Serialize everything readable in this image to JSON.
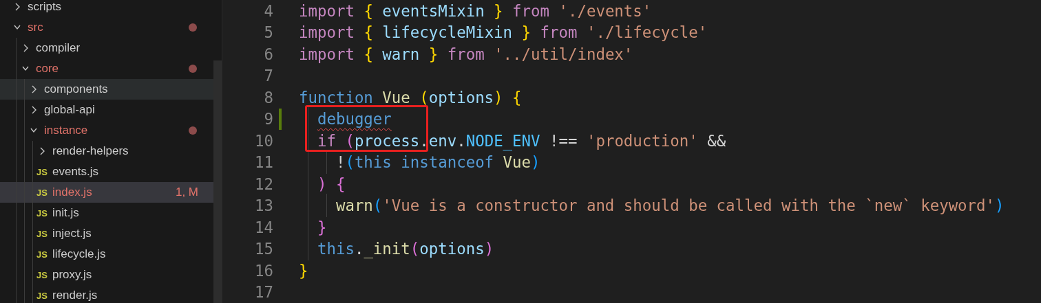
{
  "explorer": {
    "items": [
      {
        "kind": "folder",
        "label": "scripts",
        "expanded": false,
        "modified": false,
        "selected": false,
        "hovered": false
      },
      {
        "kind": "folder",
        "label": "src",
        "expanded": true,
        "modified": true,
        "selected": false,
        "hovered": false,
        "children": [
          {
            "kind": "folder",
            "label": "compiler",
            "expanded": false,
            "modified": false,
            "selected": false,
            "hovered": false
          },
          {
            "kind": "folder",
            "label": "core",
            "expanded": true,
            "modified": true,
            "selected": false,
            "hovered": false,
            "children": [
              {
                "kind": "folder",
                "label": "components",
                "expanded": false,
                "modified": false,
                "selected": false,
                "hovered": true
              },
              {
                "kind": "folder",
                "label": "global-api",
                "expanded": false,
                "modified": false,
                "selected": false,
                "hovered": false
              },
              {
                "kind": "folder",
                "label": "instance",
                "expanded": true,
                "modified": true,
                "selected": false,
                "hovered": false,
                "children": [
                  {
                    "kind": "folder",
                    "label": "render-helpers",
                    "expanded": false,
                    "modified": false,
                    "selected": false,
                    "hovered": false
                  },
                  {
                    "kind": "file",
                    "icon_text": "JS",
                    "label": "events.js",
                    "modified": false,
                    "selected": false,
                    "hovered": false
                  },
                  {
                    "kind": "file",
                    "icon_text": "JS",
                    "label": "index.js",
                    "modified": true,
                    "badge": "1, M",
                    "selected": true,
                    "hovered": false
                  },
                  {
                    "kind": "file",
                    "icon_text": "JS",
                    "label": "init.js",
                    "modified": false,
                    "selected": false,
                    "hovered": false
                  },
                  {
                    "kind": "file",
                    "icon_text": "JS",
                    "label": "inject.js",
                    "modified": false,
                    "selected": false,
                    "hovered": false
                  },
                  {
                    "kind": "file",
                    "icon_text": "JS",
                    "label": "lifecycle.js",
                    "modified": false,
                    "selected": false,
                    "hovered": false
                  },
                  {
                    "kind": "file",
                    "icon_text": "JS",
                    "label": "proxy.js",
                    "modified": false,
                    "selected": false,
                    "hovered": false
                  },
                  {
                    "kind": "file",
                    "icon_text": "JS",
                    "label": "render.js",
                    "modified": false,
                    "selected": false,
                    "hovered": false
                  }
                ]
              }
            ]
          }
        ]
      }
    ]
  },
  "editor": {
    "lines": [
      {
        "number": "4",
        "modified": false,
        "tokens": [
          {
            "kind": "kw",
            "text": "import "
          },
          {
            "kind": "b1",
            "text": "{"
          },
          {
            "kind": "var",
            "text": " eventsMixin "
          },
          {
            "kind": "b1",
            "text": "}"
          },
          {
            "kind": "kw",
            "text": " from "
          },
          {
            "kind": "str",
            "text": "'./events'"
          }
        ]
      },
      {
        "number": "5",
        "modified": false,
        "tokens": [
          {
            "kind": "kw",
            "text": "import "
          },
          {
            "kind": "b1",
            "text": "{"
          },
          {
            "kind": "var",
            "text": " lifecycleMixin "
          },
          {
            "kind": "b1",
            "text": "}"
          },
          {
            "kind": "kw",
            "text": " from "
          },
          {
            "kind": "str",
            "text": "'./lifecycle'"
          }
        ]
      },
      {
        "number": "6",
        "modified": false,
        "tokens": [
          {
            "kind": "kw",
            "text": "import "
          },
          {
            "kind": "b1",
            "text": "{"
          },
          {
            "kind": "var",
            "text": " warn "
          },
          {
            "kind": "b1",
            "text": "}"
          },
          {
            "kind": "kw",
            "text": " from "
          },
          {
            "kind": "str",
            "text": "'../util/index'"
          }
        ]
      },
      {
        "number": "7",
        "modified": false
      },
      {
        "number": "8",
        "modified": false,
        "tokens": [
          {
            "kind": "decl",
            "text": "function "
          },
          {
            "kind": "fn",
            "text": "Vue "
          },
          {
            "kind": "b1",
            "text": "("
          },
          {
            "kind": "var",
            "text": "options"
          },
          {
            "kind": "b1",
            "text": ") {"
          }
        ]
      },
      {
        "number": "9",
        "modified": true,
        "tokens": [
          {
            "kind": "decl",
            "text": "  debugger",
            "error": true
          }
        ]
      },
      {
        "number": "10",
        "modified": false,
        "tokens": [
          {
            "kind": "kw",
            "text": "  if "
          },
          {
            "kind": "b2",
            "text": "("
          },
          {
            "kind": "var",
            "text": "process"
          },
          {
            "kind": "op",
            "text": "."
          },
          {
            "kind": "var",
            "text": "env"
          },
          {
            "kind": "op",
            "text": "."
          },
          {
            "kind": "const",
            "text": "NODE_ENV"
          },
          {
            "kind": "op",
            "text": " !== "
          },
          {
            "kind": "str",
            "text": "'production'"
          },
          {
            "kind": "op",
            "text": " &&"
          }
        ]
      },
      {
        "number": "11",
        "modified": false,
        "tokens": [
          {
            "kind": "op",
            "text": "    !"
          },
          {
            "kind": "b3",
            "text": "("
          },
          {
            "kind": "decl",
            "text": "this instanceof "
          },
          {
            "kind": "fn",
            "text": "Vue"
          },
          {
            "kind": "b3",
            "text": ")"
          }
        ]
      },
      {
        "number": "12",
        "modified": false,
        "tokens": [
          {
            "kind": "b2",
            "text": "  ) {"
          }
        ]
      },
      {
        "number": "13",
        "modified": false,
        "tokens": [
          {
            "kind": "fn",
            "text": "    warn"
          },
          {
            "kind": "b3",
            "text": "("
          },
          {
            "kind": "str",
            "text": "'Vue is a constructor and should be called with the `new` keyword'"
          },
          {
            "kind": "b3",
            "text": ")"
          }
        ]
      },
      {
        "number": "14",
        "modified": false,
        "tokens": [
          {
            "kind": "b2",
            "text": "  }"
          }
        ]
      },
      {
        "number": "15",
        "modified": false,
        "tokens": [
          {
            "kind": "decl",
            "text": "  this"
          },
          {
            "kind": "op",
            "text": "."
          },
          {
            "kind": "fn",
            "text": "_init"
          },
          {
            "kind": "b2",
            "text": "("
          },
          {
            "kind": "var",
            "text": "options"
          },
          {
            "kind": "b2",
            "text": ")"
          }
        ]
      },
      {
        "number": "16",
        "modified": false,
        "tokens": [
          {
            "kind": "b1",
            "text": "}"
          }
        ]
      },
      {
        "number": "17",
        "modified": false
      }
    ]
  }
}
